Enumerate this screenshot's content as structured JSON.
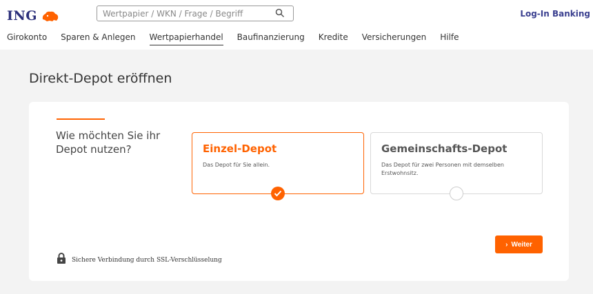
{
  "header": {
    "logo_text": "ING",
    "search_placeholder": "Wertpapier / WKN / Frage / Begriff",
    "login_label": "Log-In Banking"
  },
  "nav": {
    "items": [
      "Girokonto",
      "Sparen & Anlegen",
      "Wertpapierhandel",
      "Baufinanzierung",
      "Kredite",
      "Versicherungen",
      "Hilfe"
    ],
    "active": "Wertpapierhandel"
  },
  "page": {
    "title": "Direkt-Depot eröffnen",
    "question": "Wie möchten Sie ihr Depot nutzen?",
    "options": [
      {
        "title": "Einzel-Depot",
        "description": "Das Depot für Sie allein.",
        "selected": true
      },
      {
        "title": "Gemeinschafts-Depot",
        "description": "Das Depot für zwei Personen mit demselben Erstwohnsitz.",
        "selected": false
      }
    ],
    "next_button": "Weiter",
    "ssl_note": "Sichere Verbindung durch SSL-Verschlüsselung"
  },
  "colors": {
    "accent": "#ff6200",
    "brand": "#2b2f7a"
  }
}
